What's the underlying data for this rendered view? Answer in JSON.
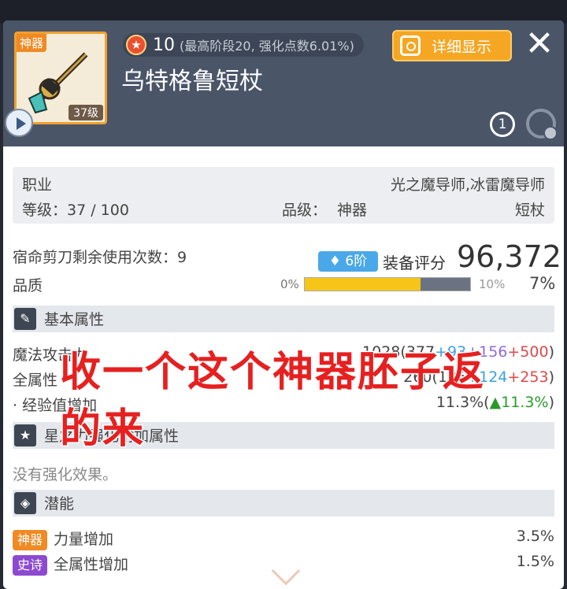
{
  "item": {
    "grade_tag": "神器",
    "level_tag": "37级",
    "star_count": "10",
    "star_note": "(最高阶段20, 强化点数6.01%)",
    "name": "乌特格鲁短杖"
  },
  "header": {
    "detail_button": "详细显示",
    "close_glyph": "✕",
    "preset_number": "1"
  },
  "info": {
    "job_label": "职业",
    "job_value": "光之魔导师,冰雷魔导师",
    "level_text": "等级：37 / 100",
    "rank_label": "品级：",
    "rank_value": "神器",
    "weapon_type": "短杖"
  },
  "scissors_text": "宿命剪刀剩余使用次数：9",
  "tier": "6阶",
  "score_label": "装备评分",
  "score_value": "96,372",
  "quality": {
    "label": "品质",
    "min": "0%",
    "max": "10%",
    "value": "7%",
    "fraction": 0.7
  },
  "sections": {
    "basic": "基本属性",
    "starforce": "星之力强化附加属性",
    "potential": "潜能"
  },
  "basic_stats": [
    {
      "name": "魔法攻击力",
      "total": "1028",
      "open": "(",
      "base": "377",
      "plus1": "+93",
      "plus2": "+156",
      "plus3": "+500",
      "close": ")"
    },
    {
      "name": "全属性",
      "total": "260",
      "open": "(",
      "base": "136",
      "plus1": "+124",
      "plus2": "",
      "plus3": "+253",
      "close": ")"
    }
  ],
  "exp_row": {
    "name": "· 经验值增加",
    "value": "11.3%(",
    "up": "▲11.3%",
    "close": ")"
  },
  "no_effect": "没有强化效果。",
  "potentials": [
    {
      "tag": "神器",
      "name": "力量增加",
      "value": "3.5%",
      "color": "#f08a24"
    },
    {
      "tag": "史诗",
      "name": "全属性增加",
      "value": "1.5%",
      "color": "#8c4ad0"
    }
  ],
  "overlay_text": {
    "line1": "收一个这个神器胚子返",
    "line2": "的来"
  },
  "colors": {
    "header_bg": "#4a5568",
    "accent_orange": "#f5a623",
    "quality_fill": "#f5c518",
    "overlay_red": "#e62020"
  }
}
